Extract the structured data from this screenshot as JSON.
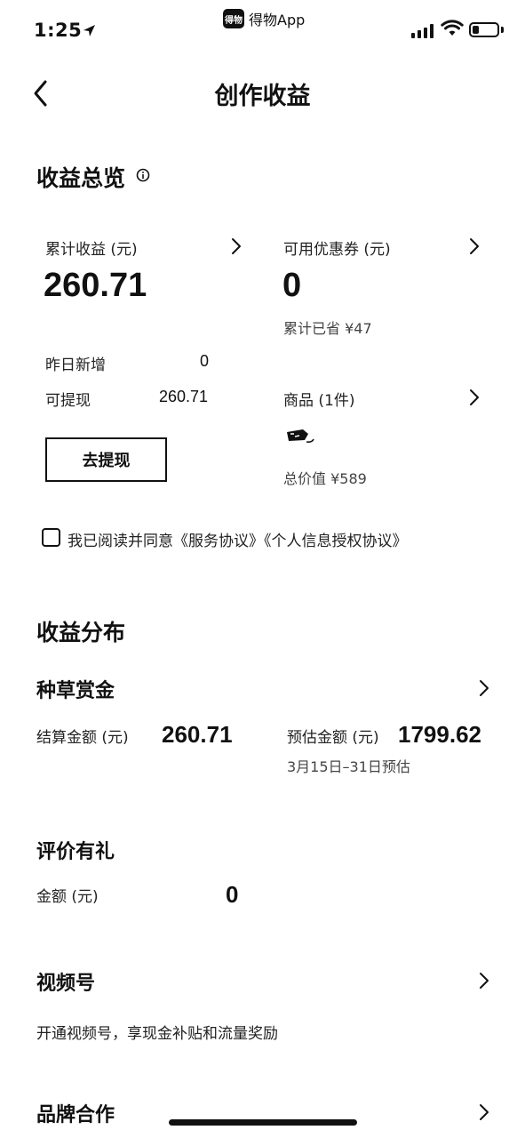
{
  "status_bar": {
    "time": "1:25",
    "app_name": "得物App",
    "app_logo_text": "得物",
    "battery_level": 0.28
  },
  "nav": {
    "title": "创作收益"
  },
  "overview": {
    "title": "收益总览",
    "cumulative_label": "累计收益 (元)",
    "cumulative_value": "260.71",
    "coupon_label": "可用优惠券 (元)",
    "coupon_value": "0",
    "saved_text": "累计已省 ¥47",
    "yesterday_label": "昨日新增",
    "yesterday_value": "0",
    "withdrawable_label": "可提现",
    "withdrawable_value": "260.71",
    "goods_label": "商品 (1件)",
    "goods_total": "总价值 ¥589",
    "withdraw_button": "去提现",
    "agreement_text": "我已阅读并同意《服务协议》《个人信息授权协议》"
  },
  "distribution": {
    "title": "收益分布",
    "seeding": {
      "title": "种草赏金",
      "settled_label": "结算金额 (元)",
      "settled_value": "260.71",
      "estimated_label": "预估金额 (元)",
      "estimated_value": "1799.62",
      "estimated_note": "3月15日–31日预估"
    },
    "review": {
      "title": "评价有礼",
      "amount_label": "金额 (元)",
      "amount_value": "0"
    },
    "video": {
      "title": "视频号",
      "desc": "开通视频号，享现金补贴和流量奖励"
    },
    "brand": {
      "title": "品牌合作"
    }
  }
}
